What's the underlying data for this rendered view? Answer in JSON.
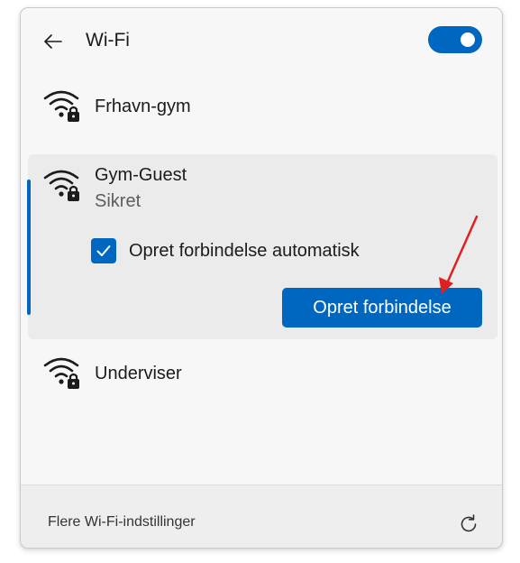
{
  "header": {
    "title": "Wi-Fi",
    "wifi_enabled": true
  },
  "networks": [
    {
      "name": "Frhavn-gym",
      "secured": true,
      "expanded": false
    },
    {
      "name": "Gym-Guest",
      "status": "Sikret",
      "secured": true,
      "expanded": true,
      "auto_connect_label": "Opret forbindelse automatisk",
      "auto_connect_checked": true,
      "connect_label": "Opret forbindelse"
    },
    {
      "name": "Underviser",
      "secured": true,
      "expanded": false
    }
  ],
  "footer": {
    "settings_link": "Flere Wi-Fi-indstillinger"
  },
  "icons": {
    "back": "back-arrow-icon",
    "wifi": "wifi-lock-icon",
    "check": "checkmark-icon",
    "refresh": "refresh-icon"
  },
  "colors": {
    "accent": "#0067c0",
    "annotation_arrow": "#e02020",
    "panel_bg": "#f7f7f7",
    "selected_bg": "#ebebeb"
  }
}
